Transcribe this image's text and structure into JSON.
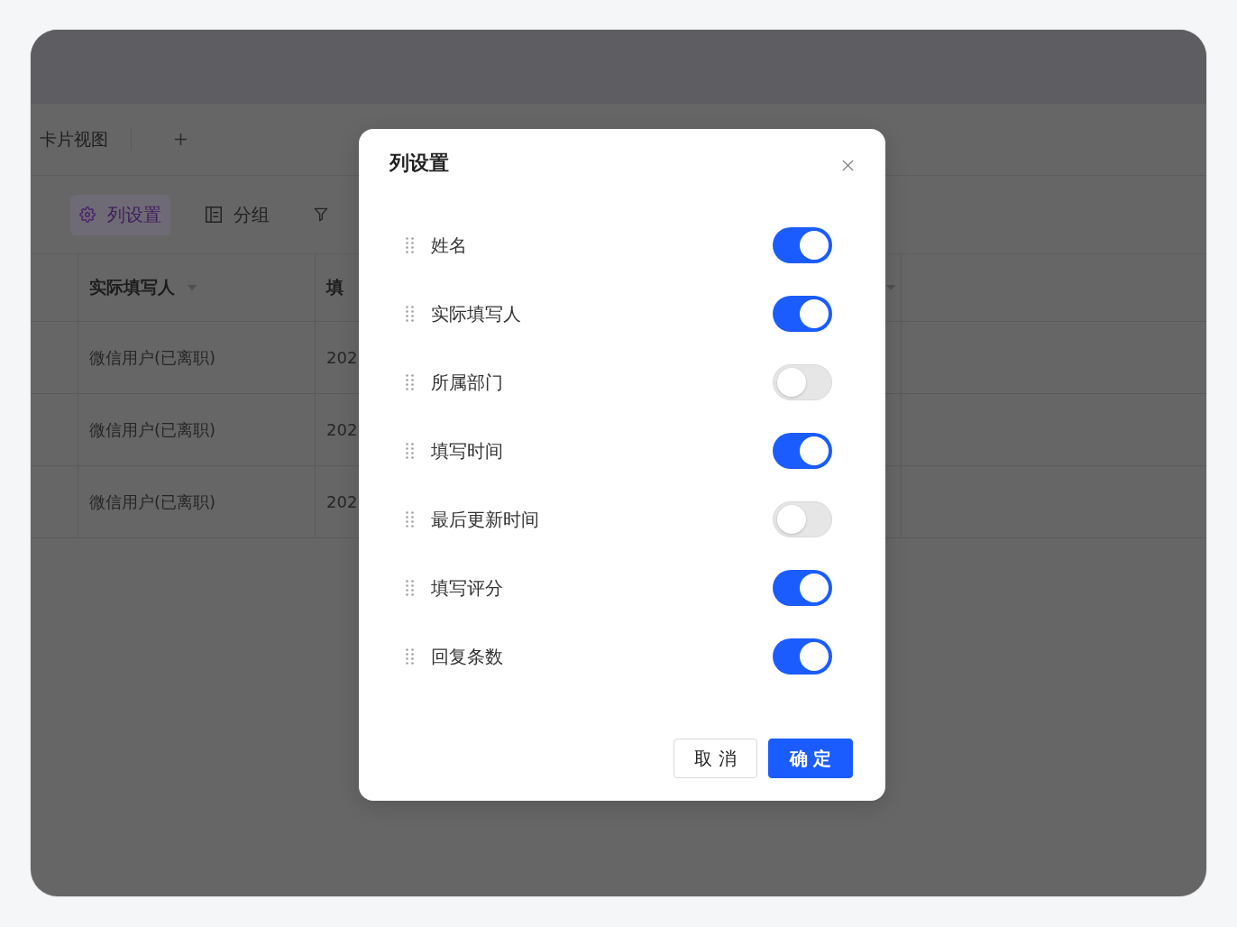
{
  "app": {
    "view_tabs": [
      {
        "label": "卡片视图"
      }
    ],
    "toolbar": [
      {
        "kind": "settings",
        "label": "列设置",
        "selected": true
      },
      {
        "kind": "group",
        "label": "分组",
        "selected": false
      },
      {
        "kind": "filter",
        "selected": false
      }
    ],
    "table": {
      "columns": [
        {
          "label": "实际填写人",
          "menu_caret": true
        },
        {
          "label": "填",
          "menu_caret": false
        },
        {
          "menu_caret": true
        }
      ],
      "rows": [
        {
          "cells": [
            "微信用户(已离职)",
            "202"
          ]
        },
        {
          "cells": [
            "微信用户(已离职)",
            "202"
          ]
        },
        {
          "cells": [
            "微信用户(已离职)",
            "202"
          ]
        }
      ]
    }
  },
  "dialog": {
    "title": "列设置",
    "items": [
      {
        "label": "姓名",
        "on": true
      },
      {
        "label": "实际填写人",
        "on": true
      },
      {
        "label": "所属部门",
        "on": false
      },
      {
        "label": "填写时间",
        "on": true
      },
      {
        "label": "最后更新时间",
        "on": false
      },
      {
        "label": "填写评分",
        "on": true
      },
      {
        "label": "回复条数",
        "on": true
      }
    ],
    "buttons": [
      {
        "label": "取 消",
        "kind": "secondary"
      },
      {
        "label": "确 定",
        "kind": "primary"
      }
    ]
  }
}
